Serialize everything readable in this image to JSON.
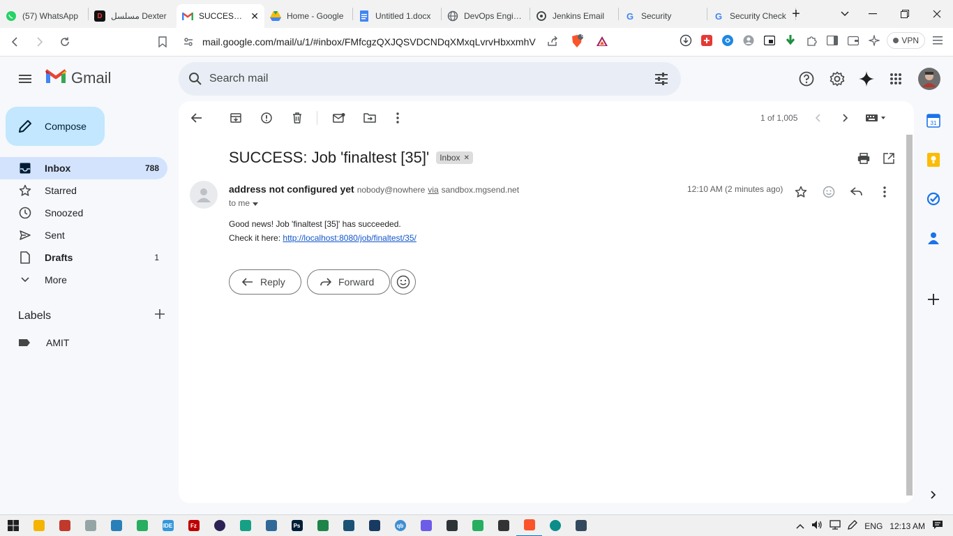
{
  "browser": {
    "tabs": [
      {
        "title": "(57) WhatsApp",
        "icon": "whatsapp-icon",
        "color": "#25d366"
      },
      {
        "title": "مسلسل Dexter",
        "icon": "dexter-icon",
        "color": "#b71c1c"
      },
      {
        "title": "SUCCESS: Job",
        "icon": "gmail-icon",
        "color": "#ea4335",
        "active": true
      },
      {
        "title": "Home - Google",
        "icon": "drive-icon",
        "color": "#1fa463"
      },
      {
        "title": "Untitled 1.docx",
        "icon": "docs-icon",
        "color": "#4285f4"
      },
      {
        "title": "DevOps Engineer",
        "icon": "globe-icon",
        "color": "#5f6368"
      },
      {
        "title": "Jenkins Email",
        "icon": "openai-icon",
        "color": "#3c4043"
      },
      {
        "title": "Security",
        "icon": "google-icon",
        "color": "#4285f4"
      },
      {
        "title": "Security Check",
        "icon": "google-icon",
        "color": "#4285f4"
      }
    ],
    "url": "mail.google.com/mail/u/1/#inbox/FMfcgzQXJQSVDCNDqXMxqLvrvHbxxmhV",
    "vpn_label": "VPN",
    "brave_badge": "6"
  },
  "gmail": {
    "logo_text": "Gmail",
    "search_placeholder": "Search mail",
    "compose_label": "Compose",
    "nav": [
      {
        "label": "Inbox",
        "count": "788",
        "icon": "inbox-icon"
      },
      {
        "label": "Starred",
        "count": "",
        "icon": "star-icon"
      },
      {
        "label": "Snoozed",
        "count": "",
        "icon": "clock-icon"
      },
      {
        "label": "Sent",
        "count": "",
        "icon": "send-icon"
      },
      {
        "label": "Drafts",
        "count": "1",
        "icon": "draft-icon"
      },
      {
        "label": "More",
        "count": "",
        "icon": "chevron-down-icon"
      }
    ],
    "labels_title": "Labels",
    "labels": [
      {
        "label": "AMIT"
      }
    ]
  },
  "message": {
    "pager": "1 of 1,005",
    "subject": "SUCCESS: Job 'finaltest [35]'",
    "label_chip": "Inbox",
    "sender_name": "address not configured yet",
    "sender_email": "nobody@nowhere",
    "via_label": "via",
    "via_domain": "sandbox.mgsend.net",
    "to": "to me",
    "time": "12:10 AM (2 minutes ago)",
    "body_line1": "Good news! Job 'finaltest [35]' has succeeded.",
    "body_line2_prefix": "Check it here:",
    "body_link": "http://localhost:8080/job/finaltest/35/",
    "reply_label": "Reply",
    "forward_label": "Forward"
  },
  "taskbar": {
    "language": "ENG",
    "clock": "12:13 AM"
  },
  "colors": {
    "compose_bg": "#c2e7ff",
    "active_nav_bg": "#d3e3fd",
    "search_bg": "#e9eef6",
    "link": "#1155cc"
  }
}
